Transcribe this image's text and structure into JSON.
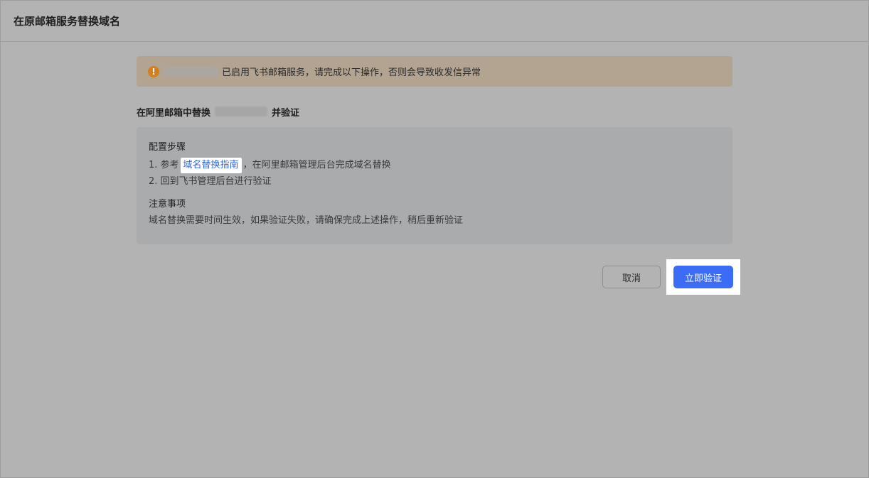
{
  "header": {
    "title": "在原邮箱服务替换域名"
  },
  "banner": {
    "icon": "warning-icon",
    "icon_glyph": "!",
    "accent_color": "#d47e1e",
    "message": "已启用飞书邮箱服务，请完成以下操作，否则会导致收发信异常"
  },
  "section": {
    "title_prefix": "在阿里邮箱中替换",
    "title_suffix": "并验证"
  },
  "steps": {
    "heading": "配置步骤",
    "step1_prefix": "1. 参考",
    "step1_link": "域名替换指南",
    "step1_suffix": "，在阿里邮箱管理后台完成域名替换",
    "step2": "2. 回到飞书管理后台进行验证"
  },
  "notice": {
    "heading": "注意事项",
    "text": "域名替换需要时间生效，如果验证失败，请确保完成上述操作，稍后重新验证"
  },
  "actions": {
    "cancel_label": "取消",
    "verify_label": "立即验证",
    "primary_color": "#3c6cf5"
  }
}
